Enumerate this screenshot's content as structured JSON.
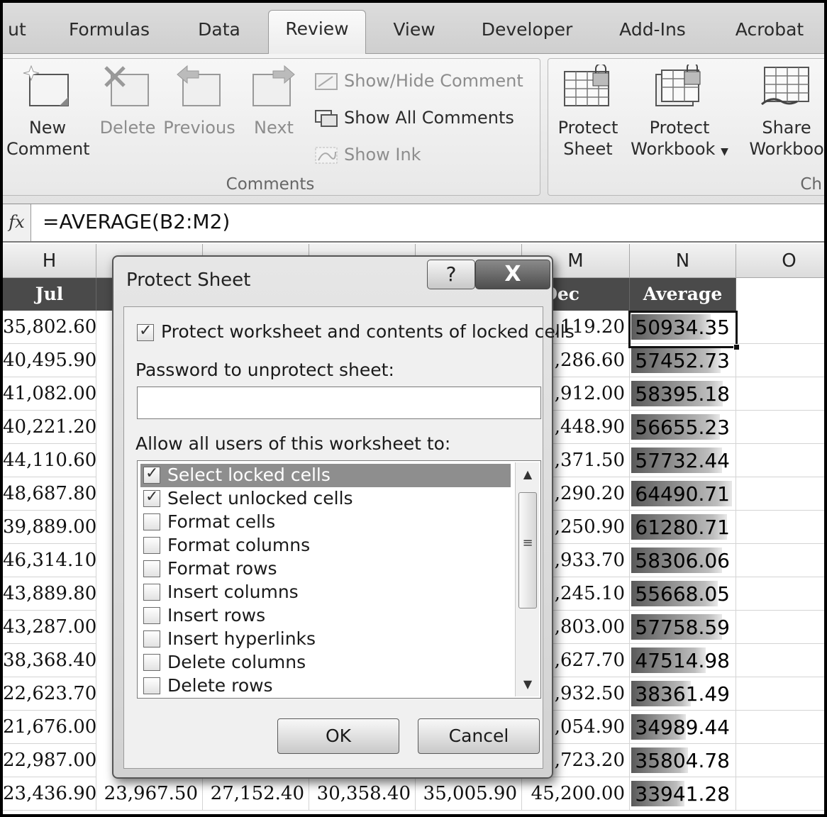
{
  "ribbon_tabs": {
    "partial_left": "ut",
    "formulas": "Formulas",
    "data": "Data",
    "review": "Review",
    "view": "View",
    "developer": "Developer",
    "addins": "Add-Ins",
    "acrobat": "Acrobat"
  },
  "comments_group": {
    "label": "Comments",
    "new_comment_line1": "New",
    "new_comment_line2": "Comment",
    "delete": "Delete",
    "previous": "Previous",
    "next": "Next",
    "show_hide_comment": "Show/Hide Comment",
    "show_all_comments": "Show All Comments",
    "show_ink": "Show Ink"
  },
  "changes_group": {
    "label_partial": "Ch",
    "protect_sheet_line1": "Protect",
    "protect_sheet_line2": "Sheet",
    "protect_workbook_line1": "Protect",
    "protect_workbook_line2": "Workbook",
    "share_workbook_line1": "Share",
    "share_workbook_line2": "Workboo"
  },
  "formula_bar": {
    "fx_label": "fx",
    "formula": "=AVERAGE(B2:M2)"
  },
  "sheet": {
    "col_h": "H",
    "col_m": "M",
    "col_n": "N",
    "col_o": "O",
    "header_jul": "Jul",
    "header_dec": "Dec",
    "header_average": "Average",
    "rows": [
      {
        "jul": "35,802.60",
        "dec": ",119.20",
        "avg": "50934.35",
        "avg_level": 0.79
      },
      {
        "jul": "40,495.90",
        "dec": ",286.60",
        "avg": "57452.73",
        "avg_level": 0.89
      },
      {
        "jul": "41,082.00",
        "dec": ",912.00",
        "avg": "58395.18",
        "avg_level": 0.91
      },
      {
        "jul": "40,221.20",
        "dec": ",448.90",
        "avg": "56655.23",
        "avg_level": 0.88
      },
      {
        "jul": "44,110.60",
        "dec": ",371.50",
        "avg": "57732.44",
        "avg_level": 0.9
      },
      {
        "jul": "48,687.80",
        "dec": ",290.20",
        "avg": "64490.71",
        "avg_level": 1.0
      },
      {
        "jul": "39,889.00",
        "dec": ",250.90",
        "avg": "61280.71",
        "avg_level": 0.95
      },
      {
        "jul": "46,314.10",
        "dec": ",933.70",
        "avg": "58306.06",
        "avg_level": 0.9
      },
      {
        "jul": "43,889.80",
        "dec": ",245.10",
        "avg": "55668.05",
        "avg_level": 0.86
      },
      {
        "jul": "43,287.00",
        "dec": ",803.00",
        "avg": "57758.59",
        "avg_level": 0.9
      },
      {
        "jul": "38,368.40",
        "dec": ",627.70",
        "avg": "47514.98",
        "avg_level": 0.74
      },
      {
        "jul": "22,623.70",
        "dec": ",932.50",
        "avg": "38361.49",
        "avg_level": 0.59
      },
      {
        "jul": "21,676.00",
        "dec": ",054.90",
        "avg": "34989.44",
        "avg_level": 0.54
      },
      {
        "jul": "22,987.00",
        "dec": ",723.20",
        "avg": "35804.78",
        "avg_level": 0.56
      },
      {
        "jul": "23,436.90",
        "dec": "45,200.00",
        "avg": "33941.28",
        "avg_level": 0.53
      }
    ],
    "last_row_middle": [
      "23,967.50",
      "27,152.40",
      "30,358.40",
      "35,005.90"
    ]
  },
  "dialog": {
    "title": "Protect Sheet",
    "help_glyph": "?",
    "close_glyph": "X",
    "protect_checkbox_label": "Protect worksheet and contents of locked cells",
    "protect_checked": true,
    "password_label": "Password to unprotect sheet:",
    "password_value": "",
    "allow_label": "Allow all users of this worksheet to:",
    "permissions": [
      {
        "label": "Select locked cells",
        "checked": true
      },
      {
        "label": "Select unlocked cells",
        "checked": true
      },
      {
        "label": "Format cells",
        "checked": false
      },
      {
        "label": "Format columns",
        "checked": false
      },
      {
        "label": "Format rows",
        "checked": false
      },
      {
        "label": "Insert columns",
        "checked": false
      },
      {
        "label": "Insert rows",
        "checked": false
      },
      {
        "label": "Insert hyperlinks",
        "checked": false
      },
      {
        "label": "Delete columns",
        "checked": false
      },
      {
        "label": "Delete rows",
        "checked": false
      }
    ],
    "ok_label": "OK",
    "cancel_label": "Cancel"
  }
}
